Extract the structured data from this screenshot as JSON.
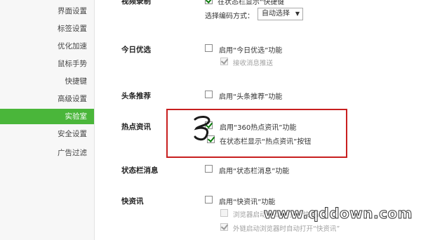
{
  "sidebar": {
    "items": [
      {
        "label": "界面设置"
      },
      {
        "label": "标签设置"
      },
      {
        "label": "优化加速"
      },
      {
        "label": "鼠标手势"
      },
      {
        "label": "快捷键"
      },
      {
        "label": "高级设置"
      },
      {
        "label": "实验室",
        "active": true
      },
      {
        "label": "安全设置"
      },
      {
        "label": "广告过滤"
      }
    ]
  },
  "sections": {
    "video": {
      "label": "视频录制",
      "option1": "在状态栏显示“快捷键",
      "encode_label": "选择编码方式：",
      "encode_value": "自动选择"
    },
    "today": {
      "label": "今日优选",
      "enable": "启用“今日优选”功能",
      "receive": "接收消息推送"
    },
    "headline": {
      "label": "头条推荐",
      "enable": "启用“头条推荐”功能"
    },
    "hot": {
      "label": "热点资讯",
      "enable": "启用“360热点资讯”功能",
      "statusbar": "在状态栏显示“热点资讯”按钮"
    },
    "statusmsg": {
      "label": "状态栏消息",
      "enable": "启用“状态栏消息”功能"
    },
    "quick": {
      "label": "快资讯",
      "enable": "启用“快资讯”功能",
      "sub1": "浏览器启动时自动打开“快资讯”",
      "sub2": "外链启动浏览器时自动打开“快资讯”"
    }
  },
  "watermark": "www.qddown.com",
  "colors": {
    "sidebar_active": "#4ab63a",
    "annotation_box": "#c81f1f",
    "check": "#0a7a0a"
  }
}
